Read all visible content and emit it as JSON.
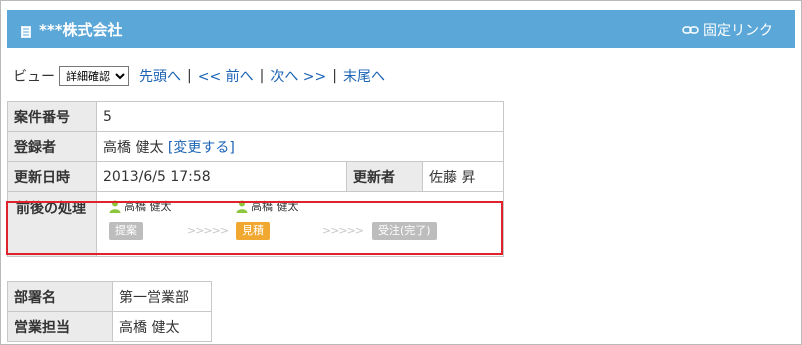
{
  "header": {
    "title": "***株式会社",
    "permalink_label": "固定リンク"
  },
  "nav": {
    "view_label": "ビュー",
    "view_selected": "詳細確認",
    "links": [
      "先頭へ",
      "<< 前へ",
      "次へ >>",
      "末尾へ"
    ]
  },
  "record": {
    "case_no_label": "案件番号",
    "case_no": "5",
    "registrant_label": "登録者",
    "registrant": "高橋 健太",
    "change_link": "[変更する]",
    "updated_label": "更新日時",
    "updated": "2013/6/5 17:58",
    "updater_label": "更新者",
    "updater": "佐藤 昇",
    "flow_label": "前後の処理",
    "flow": {
      "user1": "高橋 健太",
      "user2": "高橋 健太",
      "step1": "提案",
      "step2": "見積",
      "step3": "受注(完了)",
      "arrows": ">>>>>"
    }
  },
  "sub": {
    "dept_label": "部署名",
    "dept": "第一営業部",
    "sales_label": "営業担当",
    "sales": "高橋 健太"
  },
  "colors": {
    "header_bg": "#5aa7d8",
    "highlight_border": "#e0232b",
    "current_step": "#f0a830",
    "done_step": "#bdbdbd"
  }
}
